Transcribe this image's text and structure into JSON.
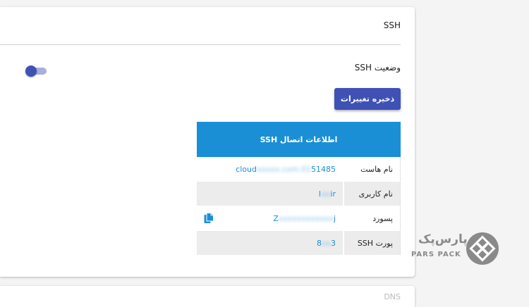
{
  "section": {
    "title": "SSH",
    "status_label": "وضعیت SSH",
    "save_label": "ذخیره تغییرات"
  },
  "info": {
    "header": "اطلاعات اتصال SSH",
    "rows": [
      {
        "label": "نام هاست",
        "value_prefix": "cloud",
        "value_hidden": "xxxxx.com.01",
        "value_suffix": "51485"
      },
      {
        "label": "نام کاربری",
        "value_prefix": "l",
        "value_hidden": "oo",
        "value_suffix": "ir"
      },
      {
        "label": "پسورد",
        "value_prefix": "Z",
        "value_hidden": "xxxxxxxxxxxx",
        "value_suffix": "j"
      },
      {
        "label": "پورت SSH",
        "value_prefix": "8",
        "value_hidden": "xx",
        "value_suffix": "3"
      }
    ]
  },
  "logo": {
    "fa": "پارس‌پک",
    "en": "PARS PACK"
  },
  "next_section": {
    "title": "DNS"
  },
  "colors": {
    "primary": "#3f51b5",
    "header": "#1a8fd6",
    "link": "#1a8fd6"
  },
  "icons": {
    "copy": "copy-icon",
    "toggle": "toggle-switch"
  },
  "toggle_on": false
}
